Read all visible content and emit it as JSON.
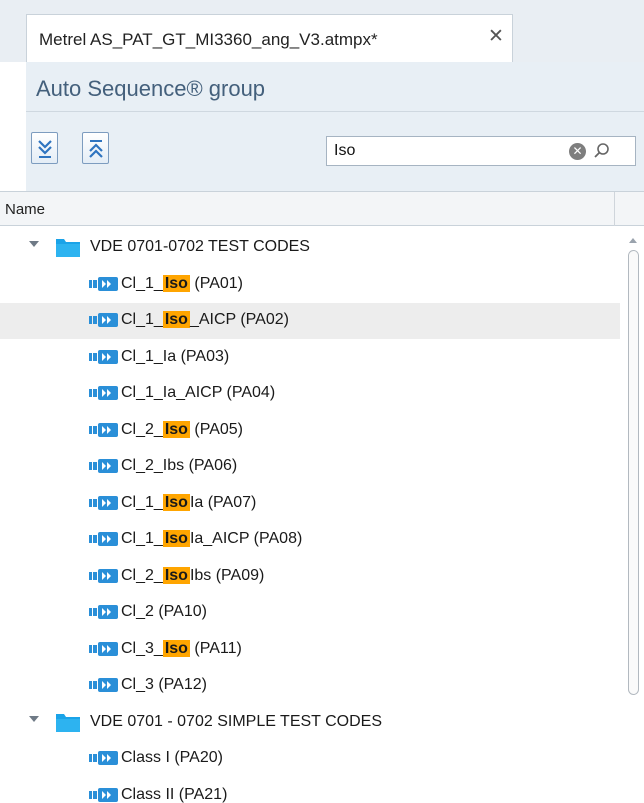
{
  "tab": {
    "title": "Metrel AS_PAT_GT_MI3360_ang_V3.atmpx*",
    "close_glyph": "✕"
  },
  "panel": {
    "title": "Auto Sequence® group"
  },
  "toolbar": {
    "expand_icon": "expand-all-icon",
    "collapse_icon": "collapse-all-icon"
  },
  "search": {
    "value": "Iso",
    "clear_glyph": "✕",
    "search_icon": "search-icon"
  },
  "list": {
    "column_name": "Name"
  },
  "tree": [
    {
      "type": "group",
      "label": "VDE 0701-0702 TEST CODES"
    },
    {
      "type": "item",
      "pre": "Cl_1_",
      "match": "Iso",
      "post": " (PA01)"
    },
    {
      "type": "item",
      "pre": "Cl_1_",
      "match": "Iso",
      "post": "_AICP (PA02)",
      "selected": true
    },
    {
      "type": "item",
      "pre": "Cl_1_Ia (PA03)"
    },
    {
      "type": "item",
      "pre": "Cl_1_Ia_AICP (PA04)"
    },
    {
      "type": "item",
      "pre": "Cl_2_",
      "match": "Iso",
      "post": " (PA05)"
    },
    {
      "type": "item",
      "pre": "Cl_2_Ibs (PA06)"
    },
    {
      "type": "item",
      "pre": "Cl_1_",
      "match": "Iso",
      "post": "Ia (PA07)"
    },
    {
      "type": "item",
      "pre": "Cl_1_",
      "match": "Iso",
      "post": "Ia_AICP (PA08)"
    },
    {
      "type": "item",
      "pre": "Cl_2_",
      "match": "Iso",
      "post": "Ibs (PA09)"
    },
    {
      "type": "item",
      "pre": "Cl_2 (PA10)"
    },
    {
      "type": "item",
      "pre": "Cl_3_",
      "match": "Iso",
      "post": " (PA11)"
    },
    {
      "type": "item",
      "pre": "Cl_3 (PA12)"
    },
    {
      "type": "group",
      "label": "VDE 0701 - 0702 SIMPLE TEST CODES"
    },
    {
      "type": "item",
      "pre": "Class I (PA20)"
    },
    {
      "type": "item",
      "pre": "Class II (PA21)"
    }
  ],
  "colors": {
    "highlight": "#ffa500",
    "folder": "#1aa3e8",
    "accent": "#44607c",
    "selected_row": "#ededed"
  }
}
